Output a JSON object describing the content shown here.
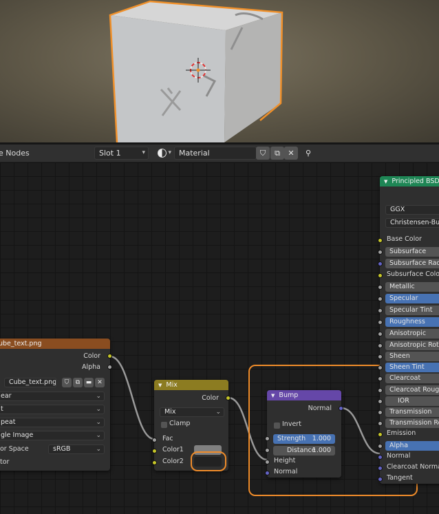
{
  "header": {
    "editor_title": "e Nodes",
    "slot": "Slot 1",
    "material_name": "Material"
  },
  "nodes": {
    "image_texture": {
      "title": "ube_text.png",
      "outputs": {
        "color": "Color",
        "alpha": "Alpha"
      },
      "image_name": "Cube_text.png",
      "interpolation": "ear",
      "projection": "t",
      "extension": "peat",
      "source": "gle Image",
      "color_space_label": "or Space",
      "color_space_value": "sRGB",
      "vector_label": "tor"
    },
    "mix": {
      "title": "Mix",
      "output": "Color",
      "blend_type": "Mix",
      "clamp": "Clamp",
      "fac": "Fac",
      "color1": "Color1",
      "color2": "Color2"
    },
    "bump": {
      "title": "Bump",
      "output": "Normal",
      "invert": "Invert",
      "strength_label": "Strength",
      "strength_value": "1.000",
      "distance_label": "Distance",
      "distance_value": "1.000",
      "height": "Height",
      "normal": "Normal"
    },
    "principled": {
      "title": "Principled BSDF",
      "distribution": "GGX",
      "subsurface_method": "Christensen-Burley",
      "inputs": [
        "Base Color",
        "Subsurface",
        "Subsurface Radius",
        "Subsurface Color",
        "Metallic",
        "Specular",
        "Specular Tint",
        "Roughness",
        "Anisotropic",
        "Anisotropic Rotation",
        "Sheen",
        "Sheen Tint",
        "Clearcoat",
        "Clearcoat Roughness",
        "IOR",
        "Transmission",
        "Transmission Roughness",
        "Emission",
        "Alpha",
        "Normal",
        "Clearcoat Normal",
        "Tangent"
      ]
    }
  },
  "colors": {
    "image_header": "#8a4d20",
    "mix_header": "#8c7c21",
    "bump_header": "#6547a8",
    "bsdf_header": "#1e8655",
    "highlight": "#f08c2a",
    "slider_blue": "#4772b3"
  }
}
